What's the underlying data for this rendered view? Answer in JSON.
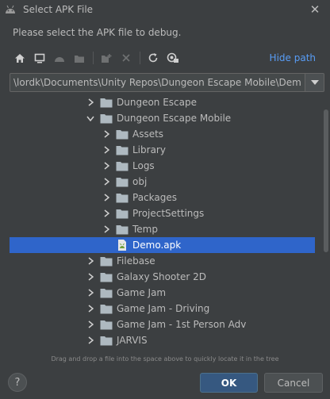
{
  "window": {
    "title": "Select APK File",
    "close_glyph": "✕"
  },
  "prompt": "Please select the APK file to debug.",
  "toolbar": {
    "hide_path": "Hide path",
    "icons": [
      "home-icon",
      "desktop-icon",
      "android-icon",
      "module-icon",
      "new-folder-icon",
      "delete-icon",
      "refresh-icon",
      "show-hidden-icon"
    ]
  },
  "path": {
    "value": "\\lordk\\Documents\\Unity Repos\\Dungeon Escape Mobile\\Demo.apk"
  },
  "tree": {
    "rows": [
      {
        "label": "Dungeon Escape",
        "level": 0,
        "expanded": false,
        "type": "folder"
      },
      {
        "label": "Dungeon Escape Mobile",
        "level": 0,
        "expanded": true,
        "type": "folder"
      },
      {
        "label": "Assets",
        "level": 1,
        "expanded": false,
        "type": "folder"
      },
      {
        "label": "Library",
        "level": 1,
        "expanded": false,
        "type": "folder"
      },
      {
        "label": "Logs",
        "level": 1,
        "expanded": false,
        "type": "folder"
      },
      {
        "label": "obj",
        "level": 1,
        "expanded": false,
        "type": "folder"
      },
      {
        "label": "Packages",
        "level": 1,
        "expanded": false,
        "type": "folder"
      },
      {
        "label": "ProjectSettings",
        "level": 1,
        "expanded": false,
        "type": "folder"
      },
      {
        "label": "Temp",
        "level": 1,
        "expanded": false,
        "type": "folder"
      },
      {
        "label": "Demo.apk",
        "level": 1,
        "expanded": null,
        "type": "apk",
        "selected": true
      },
      {
        "label": "Filebase",
        "level": 0,
        "expanded": false,
        "type": "folder"
      },
      {
        "label": "Galaxy Shooter 2D",
        "level": 0,
        "expanded": false,
        "type": "folder"
      },
      {
        "label": "Game Jam",
        "level": 0,
        "expanded": false,
        "type": "folder"
      },
      {
        "label": "Game Jam - Driving",
        "level": 0,
        "expanded": false,
        "type": "folder"
      },
      {
        "label": "Game Jam - 1st Person Adv",
        "level": 0,
        "expanded": false,
        "type": "folder"
      },
      {
        "label": "JARVIS",
        "level": 0,
        "expanded": false,
        "type": "folder"
      }
    ]
  },
  "hint": "Drag and drop a file into the space above to quickly locate it in the tree",
  "buttons": {
    "help": "?",
    "ok": "OK",
    "cancel": "Cancel"
  },
  "colors": {
    "background": "#3c3f41",
    "selection": "#2f65ca",
    "link": "#589df6",
    "ok_button": "#365880",
    "folder": "#aeb9c0"
  }
}
